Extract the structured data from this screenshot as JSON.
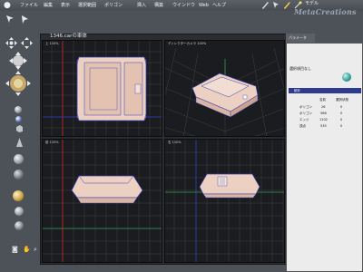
{
  "menubar": {
    "apple_icon": "apple-icon",
    "items": [
      "ファイル",
      "編集",
      "表示",
      "選択範囲",
      "ポリゴン",
      "挿入",
      "構築",
      "ウインドウ",
      "Web",
      "ヘルプ"
    ],
    "mode_label": "モデル",
    "brand": "MetaCreations"
  },
  "document": {
    "title": "1346.carの車体"
  },
  "viewports": [
    {
      "label": "上 100%"
    },
    {
      "label": "ディレクターカメラ 100%"
    },
    {
      "label": "前 100%"
    },
    {
      "label": "右 100%"
    }
  ],
  "panel": {
    "tab_label": "パラメータ",
    "selection_text": "選択項目なし",
    "section_title": "統計",
    "stats_headers": [
      "名前",
      "選択状態"
    ],
    "stats_rows": [
      {
        "label": "ポリゴン",
        "total": "26",
        "selected": "0"
      },
      {
        "label": "ポリゴン",
        "total": "566",
        "selected": "0"
      },
      {
        "label": "エッジ",
        "total": "1102",
        "selected": "0"
      },
      {
        "label": "頂点",
        "total": "535",
        "selected": "0"
      }
    ]
  },
  "colors": {
    "model_fill": "#ecd0c2",
    "model_edge": "#3a3fb6",
    "grid": "#3e4148",
    "axis_red": "#c8262c",
    "axis_blue": "#2b3cc4",
    "axis_green": "#2fa044"
  }
}
